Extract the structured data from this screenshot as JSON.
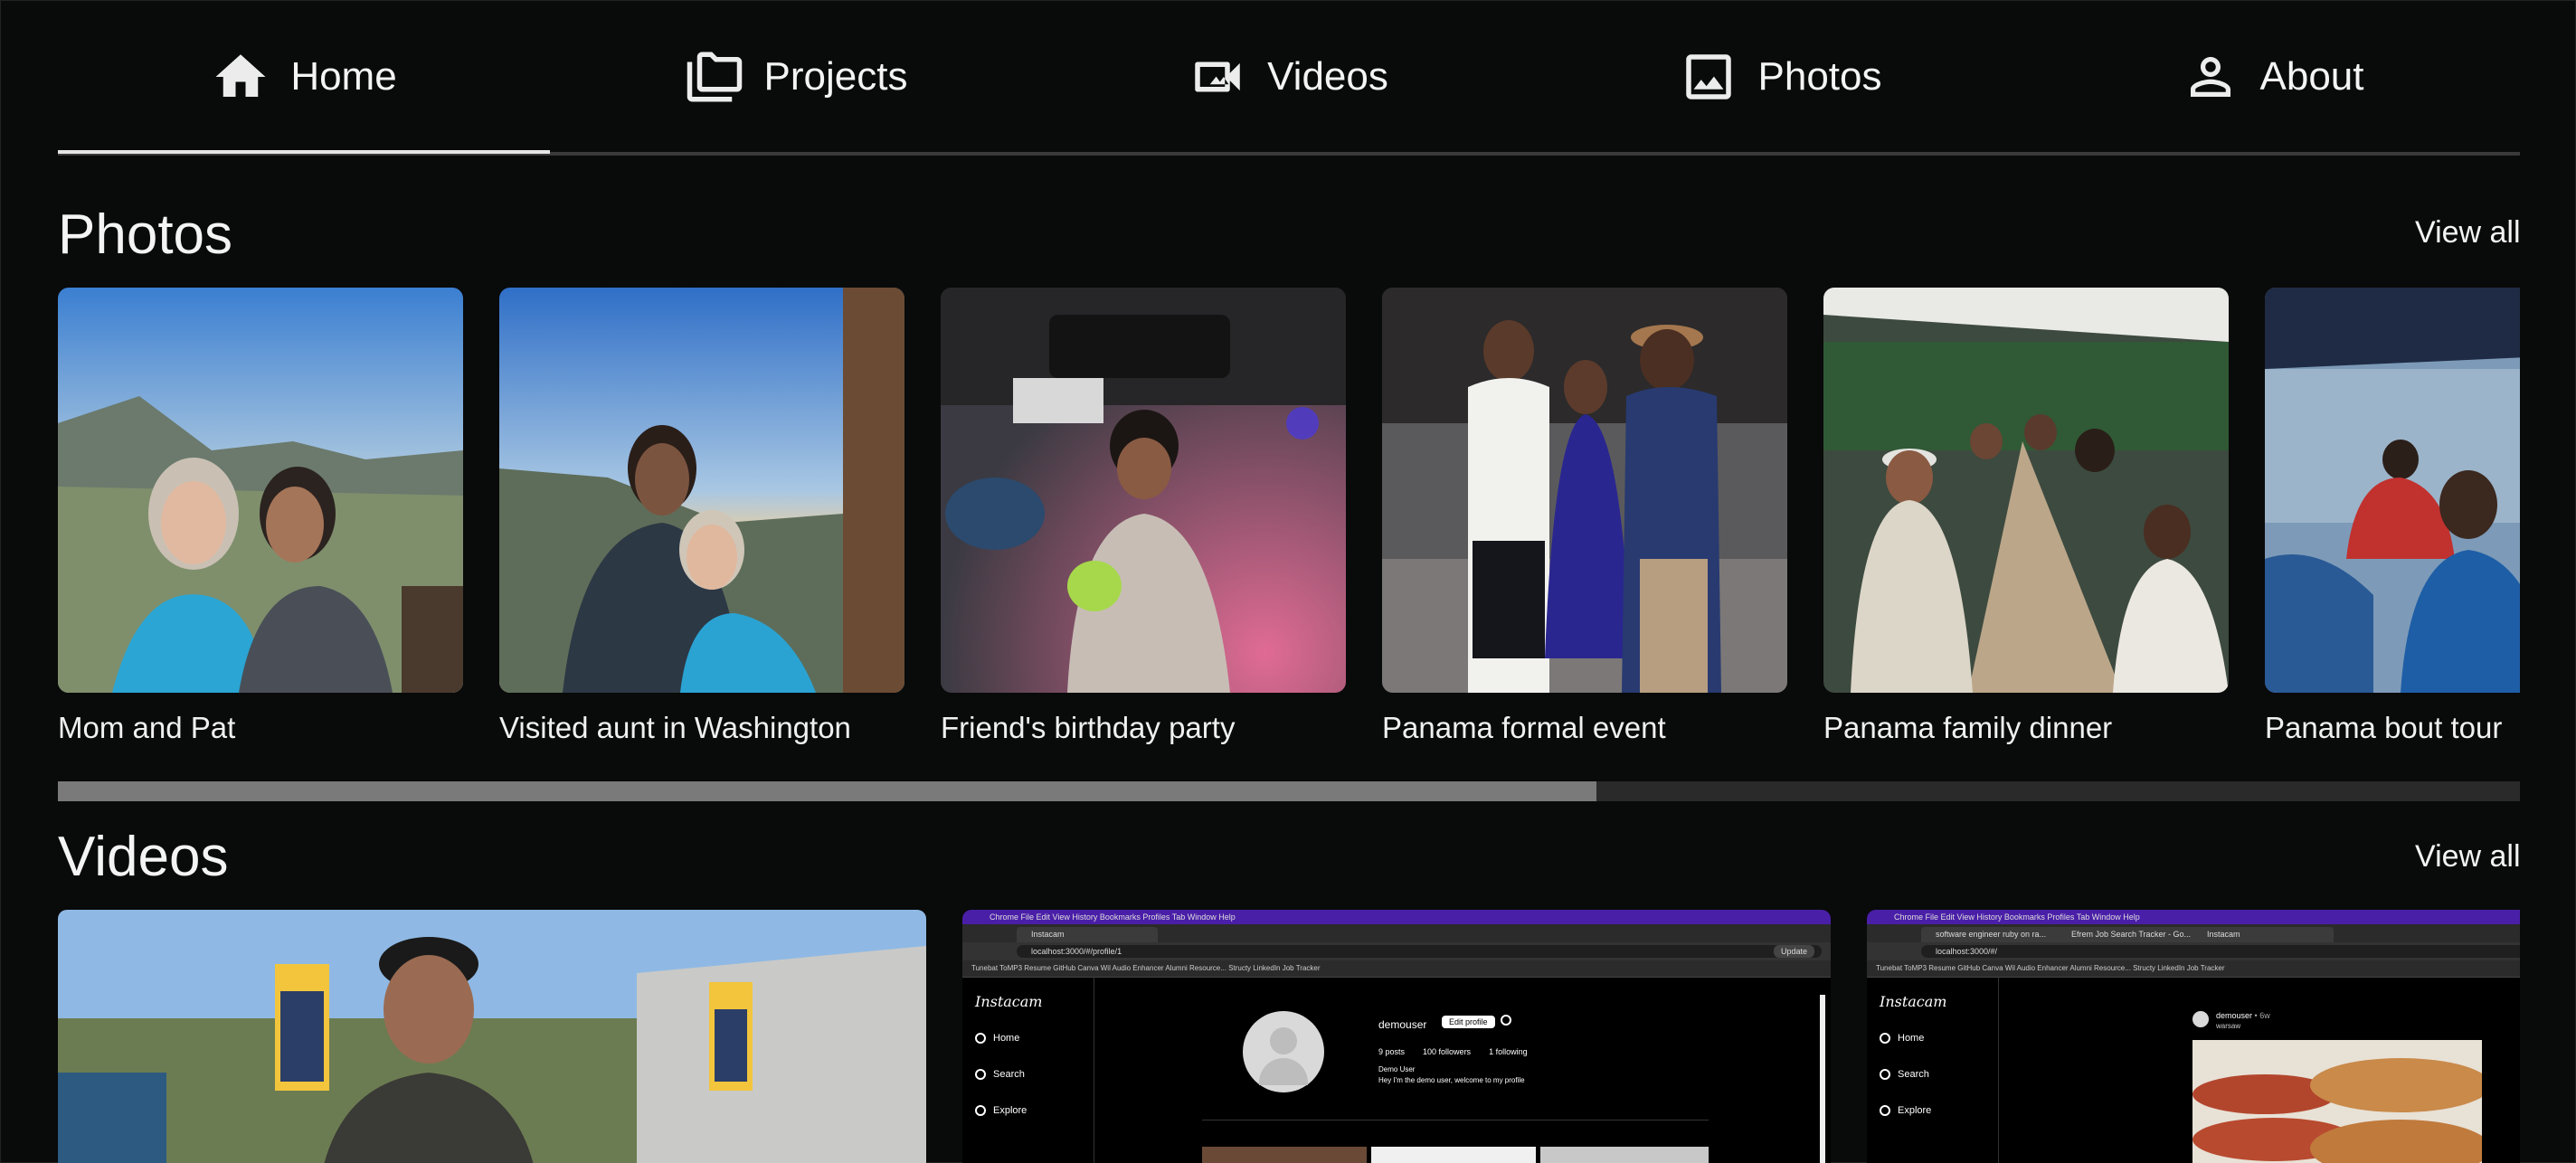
{
  "nav": {
    "tabs": [
      {
        "label": "Home",
        "icon": "home-icon"
      },
      {
        "label": "Projects",
        "icon": "folders-icon"
      },
      {
        "label": "Videos",
        "icon": "video-camera-icon"
      },
      {
        "label": "Photos",
        "icon": "image-icon"
      },
      {
        "label": "About",
        "icon": "person-icon"
      }
    ],
    "active_index": 0
  },
  "photos": {
    "title": "Photos",
    "view_all": "View all",
    "items": [
      {
        "caption": "Mom and Pat"
      },
      {
        "caption": "Visited aunt in Washington"
      },
      {
        "caption": "Friend's birthday party"
      },
      {
        "caption": "Panama formal event"
      },
      {
        "caption": "Panama family dinner"
      },
      {
        "caption": "Panama bout tour"
      }
    ],
    "scroll_fraction": 0.625
  },
  "videos": {
    "title": "Videos",
    "view_all": "View all",
    "video2": {
      "mac_menu": "Chrome   File   Edit   View   History   Bookmarks   Profiles   Tab   Window   Help",
      "tab_title": "Instacam",
      "url": "localhost:3000/#/profile/1",
      "bookmarks": "Tunebat   ToMP3   Resume   GitHub   Canva   Wil   Audio Enhancer   Alumni Resource...   Structy   LinkedIn   Job Tracker",
      "update": "Update",
      "logo": "Instacam",
      "nav": [
        "Home",
        "Search",
        "Explore"
      ],
      "username": "demouser",
      "edit_profile": "Edit profile",
      "posts": "9 posts",
      "followers": "100 followers",
      "following": "1 following",
      "display_name": "Demo User",
      "bio": "Hey I'm the demo user, welcome to my profile"
    },
    "video3": {
      "mac_menu": "Chrome   File   Edit   View   History   Bookmarks   Profiles   Tab   Window   Help",
      "tabs": [
        "software engineer ruby on ra...",
        "Efrem Job Search Tracker - Go...",
        "Instacam"
      ],
      "url": "localhost:3000/#/",
      "bookmarks": "Tunebat   ToMP3   Resume   GitHub   Canva   Wil   Audio Enhancer   Alumni Resource...   Structy   LinkedIn   Job Tracker",
      "logo": "Instacam",
      "nav": [
        "Home",
        "Search",
        "Explore"
      ],
      "post_user": "demouser",
      "post_time": "• 6w",
      "post_location": "warsaw",
      "more": "..."
    }
  },
  "colors": {
    "background": "#090a0a",
    "text": "#f2f2f2",
    "nav_indicator": "#e6e6e6",
    "scrollbar_track": "#2a2a2a",
    "scrollbar_thumb": "#7a7a7a",
    "mac_menubar": "#4a1fa8"
  }
}
